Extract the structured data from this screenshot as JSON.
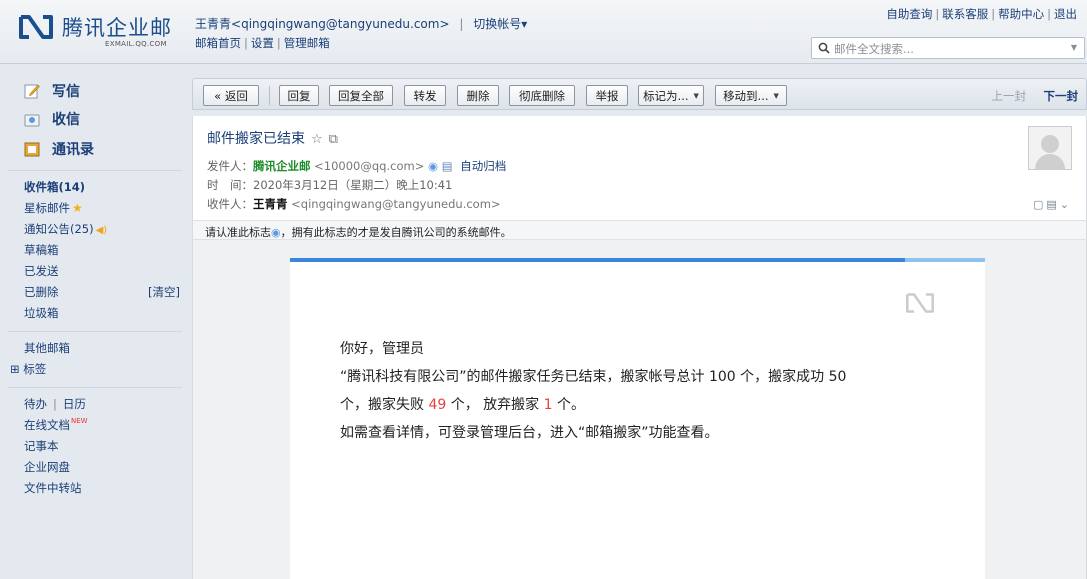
{
  "header": {
    "logo_text": "腾讯企业邮",
    "logo_sub": "EXMAIL.QQ.COM",
    "account_name": "王青青",
    "account_email": "<qingqingwang@tangyunedu.com>",
    "switch_account": "切换帐号▾",
    "nav": [
      "邮箱首页",
      "设置",
      "管理邮箱"
    ],
    "top_links": [
      "自助查询",
      "联系客服",
      "帮助中心",
      "退出"
    ],
    "search_placeholder": "邮件全文搜索..."
  },
  "sidebar": {
    "compose": "写信",
    "inbox": "收信",
    "contacts": "通讯录",
    "folders": {
      "inbox": "收件箱(14)",
      "starred": "星标邮件",
      "notices": "通知公告(25)",
      "drafts": "草稿箱",
      "sent": "已发送",
      "deleted": "已删除",
      "clear": "[清空]",
      "spam": "垃圾箱"
    },
    "other_mailbox": "其他邮箱",
    "tags": "⊞ 标签",
    "todo": "待办",
    "calendar": "日历",
    "docs": "在线文档",
    "new_badge": "NEW",
    "notes": "记事本",
    "netdisk": "企业网盘",
    "transfer": "文件中转站"
  },
  "toolbar": {
    "back": "« 返回",
    "reply": "回复",
    "reply_all": "回复全部",
    "forward": "转发",
    "delete": "删除",
    "delete_forever": "彻底删除",
    "report": "举报",
    "mark_as": "标记为...",
    "move_to": "移动到...",
    "prev": "上一封",
    "next": "下一封"
  },
  "mail": {
    "subject": "邮件搬家已结束",
    "from_label": "发件人：",
    "from_name": "腾讯企业邮",
    "from_addr": "<10000@qq.com>",
    "archive": "自动归档",
    "time_label": "时　间：",
    "time_value": "2020年3月12日（星期二）晚上10:41",
    "to_label": "收件人：",
    "to_name": "王青青",
    "to_addr": "<qingqingwang@tangyunedu.com>",
    "notice_pre": "请认准此标志",
    "notice_post": "，拥有此标志的才是发自腾讯公司的系统邮件。"
  },
  "body": {
    "greeting": "你好，管理员",
    "line1": "“腾讯科技有限公司”的邮件搬家任务已结束，搬家帐号总计 100 个，搬家成功 50",
    "line2_a": "个，搬家失败 ",
    "failed": "49",
    "line2_b": " 个， 放弃搬家 ",
    "abandoned": "1",
    "line2_c": " 个。",
    "line3": "如需查看详情，可登录管理后台，进入“邮箱搬家”功能查看。"
  }
}
